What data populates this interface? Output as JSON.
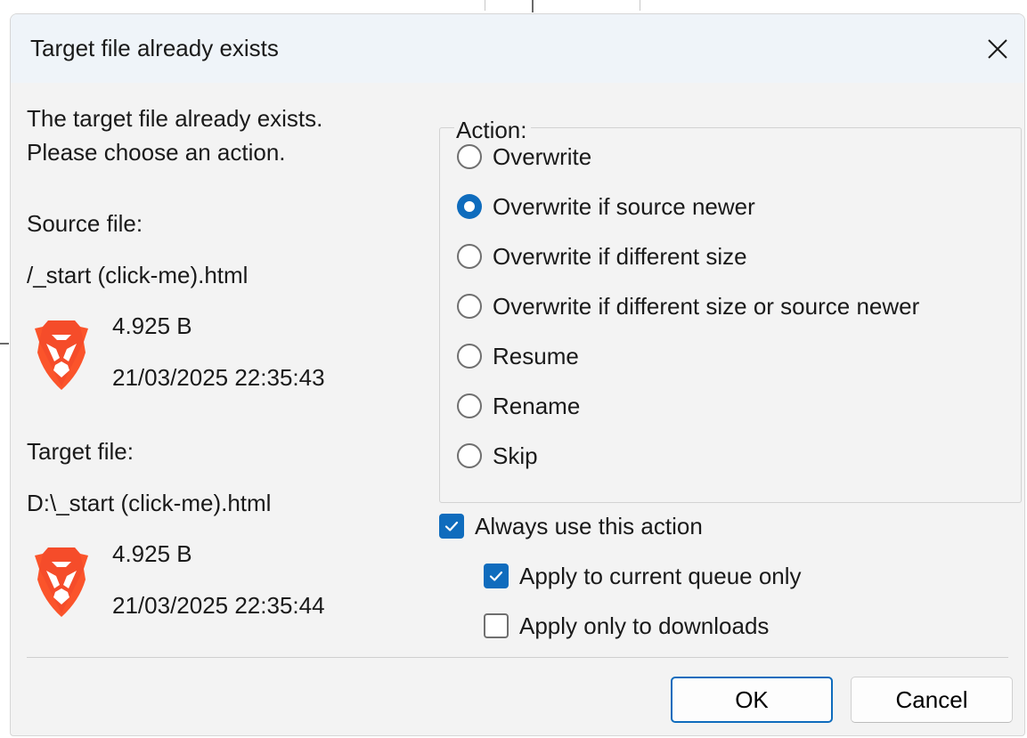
{
  "dialog": {
    "title": "Target file already exists"
  },
  "intro": {
    "line1": "The target file already exists.",
    "line2": "Please choose an action."
  },
  "source": {
    "heading": "Source file:",
    "path": "/_start (click-me).html",
    "size": "4.925 B",
    "date": "21/03/2025 22:35:43",
    "icon": "brave-browser-icon"
  },
  "target": {
    "heading": "Target file:",
    "path": "D:\\_start (click-me).html",
    "size": "4.925 B",
    "date": "21/03/2025 22:35:44",
    "icon": "brave-browser-icon"
  },
  "action": {
    "legend": "Action:",
    "options": [
      {
        "label": "Overwrite",
        "checked": false
      },
      {
        "label": "Overwrite if source newer",
        "checked": true
      },
      {
        "label": "Overwrite if different size",
        "checked": false
      },
      {
        "label": "Overwrite if different size or source newer",
        "checked": false
      },
      {
        "label": "Resume",
        "checked": false
      },
      {
        "label": "Rename",
        "checked": false
      },
      {
        "label": "Skip",
        "checked": false
      }
    ]
  },
  "options": {
    "always_use": {
      "label": "Always use this action",
      "checked": true
    },
    "current_queue": {
      "label": "Apply to current queue only",
      "checked": true
    },
    "downloads_only": {
      "label": "Apply only to downloads",
      "checked": false
    }
  },
  "buttons": {
    "ok": "OK",
    "cancel": "Cancel"
  },
  "colors": {
    "accent": "#0f6cbd",
    "brave_orange": "#fb542b",
    "dialog_bg": "#f3f3f3",
    "titlebar_bg": "#eff4f9"
  }
}
